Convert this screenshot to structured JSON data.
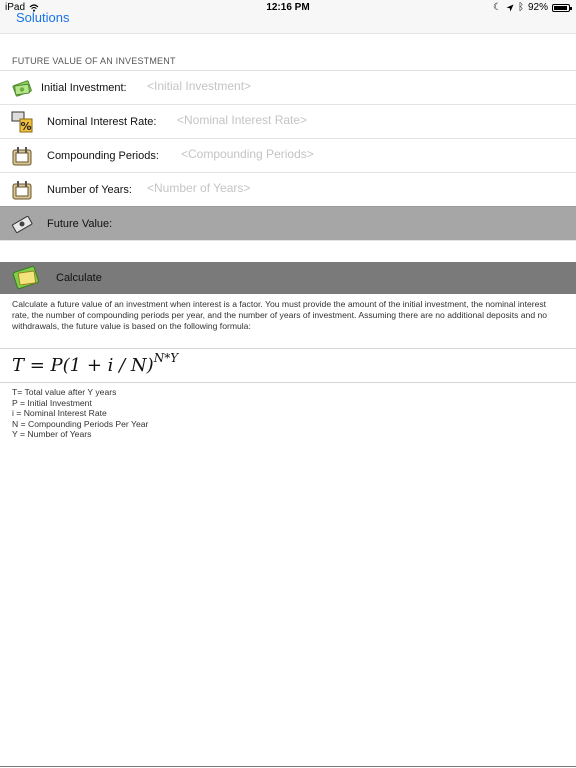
{
  "status": {
    "device": "iPad",
    "time": "12:16 PM",
    "battery_text": "92%",
    "battery_level": 0.92
  },
  "nav": {
    "back_label": "Solutions"
  },
  "form": {
    "section_title": "FUTURE VALUE OF AN INVESTMENT",
    "initial_investment": {
      "label": "Initial Investment:",
      "placeholder": "<Initial Investment>",
      "value": ""
    },
    "interest_rate": {
      "label": "Nominal Interest Rate:",
      "placeholder": "<Nominal Interest Rate>",
      "value": ""
    },
    "compounding_periods": {
      "label": "Compounding Periods:",
      "placeholder": "<Compounding Periods>",
      "value": ""
    },
    "number_of_years": {
      "label": "Number of Years:",
      "placeholder": "<Number of Years>",
      "value": ""
    },
    "future_value": {
      "label": "Future Value:",
      "value": ""
    }
  },
  "calculate": {
    "label": "Calculate"
  },
  "description": "Calculate a future value of an investment when interest is a factor.  You must provide the amount of the initial investment, the nominal interest rate, the number of compounding periods per year, and the number of years of investment.  Assuming there are no additional deposits and no withdrawals, the future value is based on the following formula:",
  "formula": {
    "main": "T = P(1 + i / N)",
    "exponent": "N*Y"
  },
  "legend": [
    "T= Total value after Y years",
    "P = Initial Investment",
    "i = Nominal Interest Rate",
    "N = Compounding Periods Per Year",
    "Y = Number of Years"
  ]
}
